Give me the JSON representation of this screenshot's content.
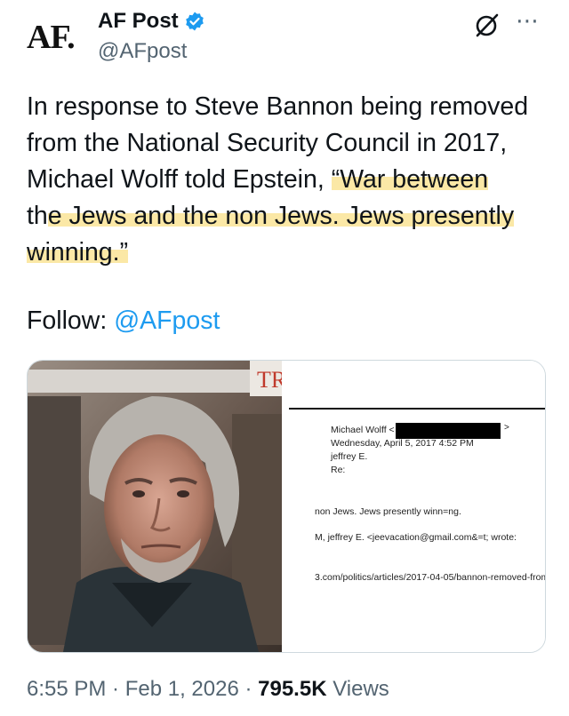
{
  "author": {
    "avatar_text": "AF.",
    "name": "AF Post",
    "handle": "@AFpost"
  },
  "tweet": {
    "line1": "In response to Steve Bannon being removed",
    "line2": "from the National Security Council in 2017,",
    "line3_plain": "Michael Wolff told Epstein, ",
    "line3_hl": "“War between",
    "line4_pre": "th",
    "line4_hl": "e Jews and the non Jews. Jews presently",
    "line5_hl": "winning.”"
  },
  "follow": {
    "label": "Follow: ",
    "link": "@AFpost"
  },
  "media": {
    "sign_text": "TR",
    "email": {
      "from": "Michael Wolff <",
      "arrow": ">",
      "date": "Wednesday, April 5, 2017 4:52 PM",
      "to": "jeffrey E.",
      "re": "Re:",
      "body": "non Jews. Jews presently winn=ng.",
      "quote": "M, jeffrey E. <jeevacation@gmail.com&=t; wrote:",
      "url": "3.com/politics/articles/2017-04-05/bannon-removed-from"
    }
  },
  "footer": {
    "time": "6:55 PM · Feb 1, 2026 · ",
    "views_count": "795.5K",
    "views_label": " Views"
  },
  "colors": {
    "link": "#1d9bf0",
    "verified": "#1d9bf0",
    "highlight": "#fbe8a6",
    "muted": "#536471"
  }
}
